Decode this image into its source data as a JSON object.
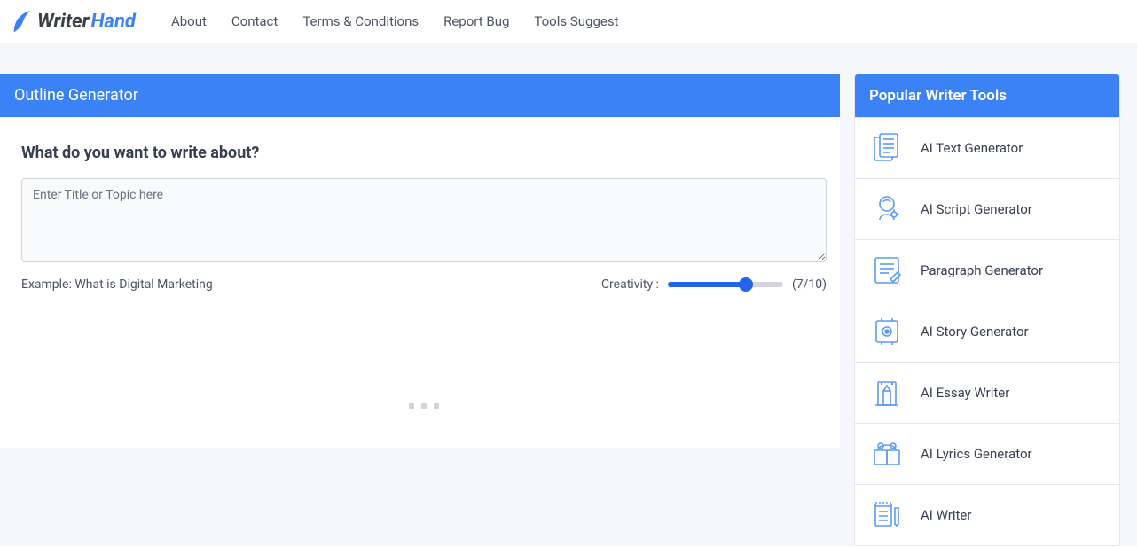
{
  "header": {
    "logo": {
      "text1": "Writer",
      "text2": "Hand"
    },
    "nav": [
      "About",
      "Contact",
      "Terms & Conditions",
      "Report Bug",
      "Tools Suggest"
    ]
  },
  "main": {
    "title": "Outline Generator",
    "question": "What do you want to write about?",
    "placeholder": "Enter Title or Topic here",
    "example": "Example: What is Digital Marketing",
    "creativity_label": "Creativity :",
    "creativity_value": 7,
    "creativity_max": 10,
    "creativity_display": "(7/10)"
  },
  "sidebar": {
    "title": "Popular Writer Tools",
    "items": [
      {
        "label": "AI Text Generator",
        "icon": "text-generator-icon"
      },
      {
        "label": "AI Script Generator",
        "icon": "script-generator-icon"
      },
      {
        "label": "Paragraph Generator",
        "icon": "paragraph-generator-icon"
      },
      {
        "label": "AI Story Generator",
        "icon": "story-generator-icon"
      },
      {
        "label": "AI Essay Writer",
        "icon": "essay-writer-icon"
      },
      {
        "label": "AI Lyrics Generator",
        "icon": "lyrics-generator-icon"
      },
      {
        "label": "AI Writer",
        "icon": "writer-icon"
      }
    ]
  },
  "colors": {
    "accent": "#3b82f6",
    "icon_stroke": "#5b9bf3"
  }
}
